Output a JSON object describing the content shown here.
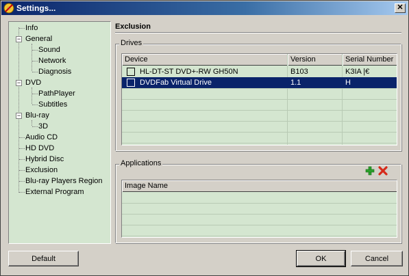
{
  "window": {
    "title": "Settings...",
    "close_glyph": "✕"
  },
  "tree": {
    "items": [
      {
        "label": "Info",
        "level": 1
      },
      {
        "label": "General",
        "level": 0,
        "expander": "−"
      },
      {
        "label": "Sound",
        "level": 2
      },
      {
        "label": "Network",
        "level": 2
      },
      {
        "label": "Diagnosis",
        "level": 2
      },
      {
        "label": "DVD",
        "level": 0,
        "expander": "−"
      },
      {
        "label": "PathPlayer",
        "level": 2
      },
      {
        "label": "Subtitles",
        "level": 2
      },
      {
        "label": "Blu-ray",
        "level": 0,
        "expander": "−"
      },
      {
        "label": "3D",
        "level": 2
      },
      {
        "label": "Audio CD",
        "level": 1
      },
      {
        "label": "HD DVD",
        "level": 1
      },
      {
        "label": "Hybrid Disc",
        "level": 1
      },
      {
        "label": "Exclusion",
        "level": 1,
        "selected": true
      },
      {
        "label": "Blu-ray Players Region",
        "level": 1
      },
      {
        "label": "External Program",
        "level": 1
      }
    ]
  },
  "section": {
    "title": "Exclusion"
  },
  "drives": {
    "legend": "Drives",
    "columns": [
      "Device",
      "Version",
      "Serial Number"
    ],
    "rows": [
      {
        "device": "HL-DT-ST DVD+-RW GH50N",
        "version": "B103",
        "serial": "K3IA |€",
        "checked": false,
        "selected": false
      },
      {
        "device": "DVDFab Virtual Drive",
        "version": "1.1",
        "serial": "H",
        "checked": false,
        "selected": true
      }
    ]
  },
  "applications": {
    "legend": "Applications",
    "add_icon": "plus-icon",
    "remove_icon": "x-icon",
    "columns": [
      "Image Name"
    ],
    "rows": []
  },
  "buttons": {
    "default": "Default",
    "ok": "OK",
    "cancel": "Cancel"
  },
  "colors": {
    "tree_bg": "#d4e6d0",
    "selection": "#0a246a",
    "add_green": "#2ca02c",
    "remove_red": "#d62a1a"
  }
}
